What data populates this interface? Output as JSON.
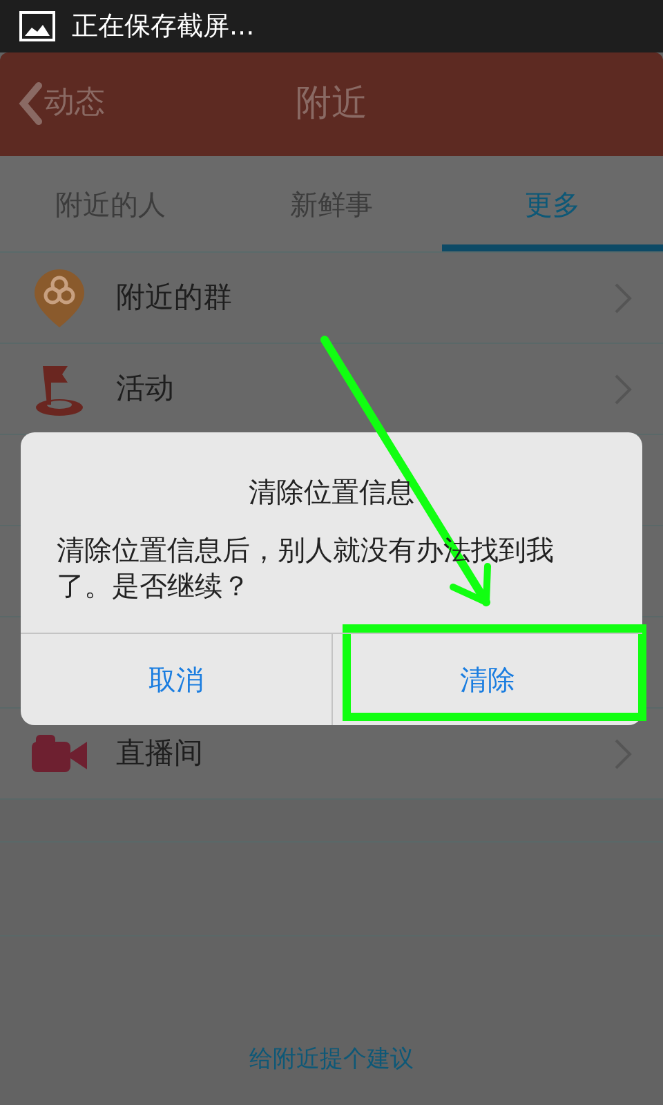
{
  "status_bar": {
    "notification": "正在保存截屏..."
  },
  "header": {
    "back": "动态",
    "title": "附近"
  },
  "tabs": [
    {
      "label": "附近的人",
      "selected": false
    },
    {
      "label": "新鲜事",
      "selected": false
    },
    {
      "label": "更多",
      "selected": true
    }
  ],
  "list": [
    {
      "kind": "group",
      "label": "附近的群"
    },
    {
      "kind": "flag",
      "label": "活动"
    },
    {
      "kind": "hidden"
    },
    {
      "kind": "hidden"
    },
    {
      "kind": "hidden"
    },
    {
      "kind": "camera",
      "label": "直播间"
    }
  ],
  "footer_link": "给附近提个建议",
  "dialog": {
    "title": "清除位置信息",
    "message": "清除位置信息后，别人就没有办法找到我了。是否继续？",
    "buttons": [
      {
        "label": "取消",
        "highlighted": false
      },
      {
        "label": "清除",
        "highlighted": true
      }
    ]
  }
}
